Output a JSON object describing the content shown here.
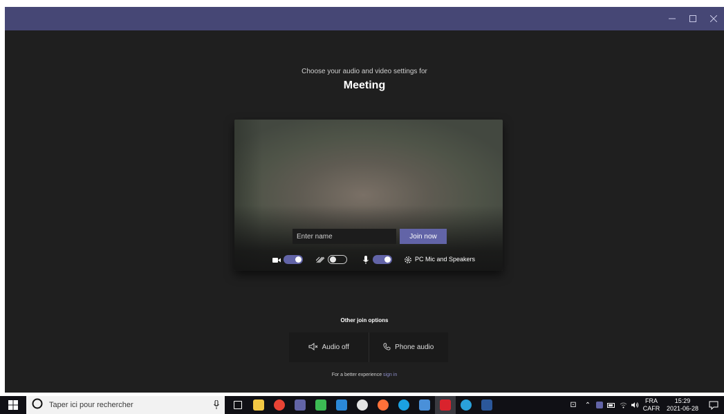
{
  "window": {
    "controls": [
      "minimize-icon",
      "maximize-icon",
      "close-icon"
    ]
  },
  "prejoin": {
    "prompt": "Choose your audio and video settings for",
    "meeting_title": "Meeting",
    "name_placeholder": "Enter name",
    "join_label": "Join now",
    "camera_on": true,
    "background_blur_on": false,
    "mic_on": true,
    "device_label": "PC Mic and Speakers"
  },
  "other_join": {
    "title": "Other join options",
    "audio_off_label": "Audio off",
    "phone_audio_label": "Phone audio",
    "better_text": "For a better experience",
    "sign_in_label": "sign in"
  },
  "taskbar": {
    "search_placeholder": "Taper ici pour rechercher",
    "apps": [
      {
        "name": "task-view-icon",
        "color": "#ffffff"
      },
      {
        "name": "file-explorer-icon",
        "color": "#f2c744"
      },
      {
        "name": "chrome-icon",
        "color": "#e94335"
      },
      {
        "name": "teams-icon",
        "color": "#6264a7"
      },
      {
        "name": "dollar-app-icon",
        "color": "#3cba54"
      },
      {
        "name": "ca-app-icon",
        "color": "#2b88d8"
      },
      {
        "name": "lock-app-icon",
        "color": "#e3e3e3"
      },
      {
        "name": "firefox-icon",
        "color": "#ff7139"
      },
      {
        "name": "edge-icon",
        "color": "#1ba1e2"
      },
      {
        "name": "remote-desktop-icon",
        "color": "#4a90d9"
      },
      {
        "name": "acrobat-icon",
        "color": "#d9232d"
      },
      {
        "name": "globe-app-icon",
        "color": "#2aa1da"
      },
      {
        "name": "word-icon",
        "color": "#2b579a"
      }
    ],
    "language": "FRA",
    "keyboard": "CAFR",
    "time": "15:29",
    "date": "2021-06-28"
  },
  "colors": {
    "titlebar": "#464775",
    "accent": "#6264a7",
    "background": "#1f1f1f",
    "taskbar": "#101015"
  }
}
